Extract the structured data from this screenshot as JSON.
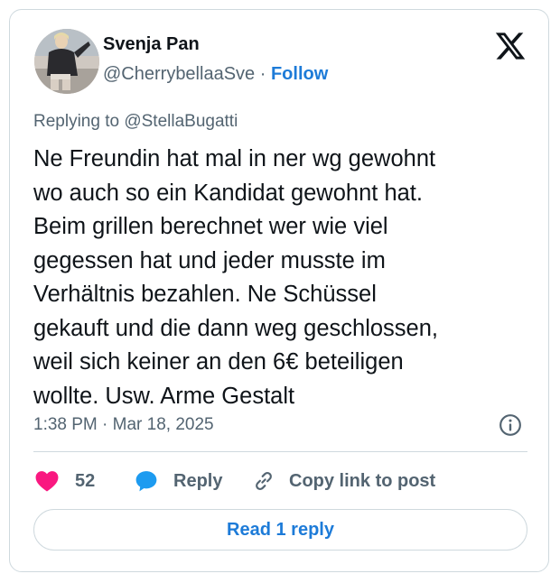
{
  "author": {
    "name": "Svenja Pan",
    "handle": "@CherrybellaaSve",
    "separator": "·",
    "follow_label": "Follow",
    "avatar_icon": "profile-photo"
  },
  "platform": {
    "logo_icon": "x-logo-icon"
  },
  "reply_context": {
    "prefix": "Replying to",
    "mention": "@StellaBugatti"
  },
  "tweet": {
    "lines": [
      "Ne Freundin hat mal in ner wg gewohnt",
      "wo auch so ein Kandidat gewohnt hat.",
      "Beim grillen berechnet wer wie viel",
      "gegessen hat und jeder musste im",
      "Verhältnis bezahlen. Ne Schüssel",
      "gekauft und die dann weg geschlossen,",
      "weil sich keiner an den 6€ beteiligen",
      "wollte. Usw. Arme Gestalt"
    ],
    "timestamp": "1:38 PM · Mar 18, 2025"
  },
  "actions": {
    "like_count": "52",
    "reply_label": "Reply",
    "copy_label": "Copy link to post"
  },
  "footer": {
    "read_replies_label": "Read 1 reply"
  },
  "colors": {
    "accent": "#1d7bd8",
    "like": "#f91880",
    "reply_icon": "#1d9bf0",
    "muted_text": "#536471",
    "border": "#cfd9de"
  }
}
